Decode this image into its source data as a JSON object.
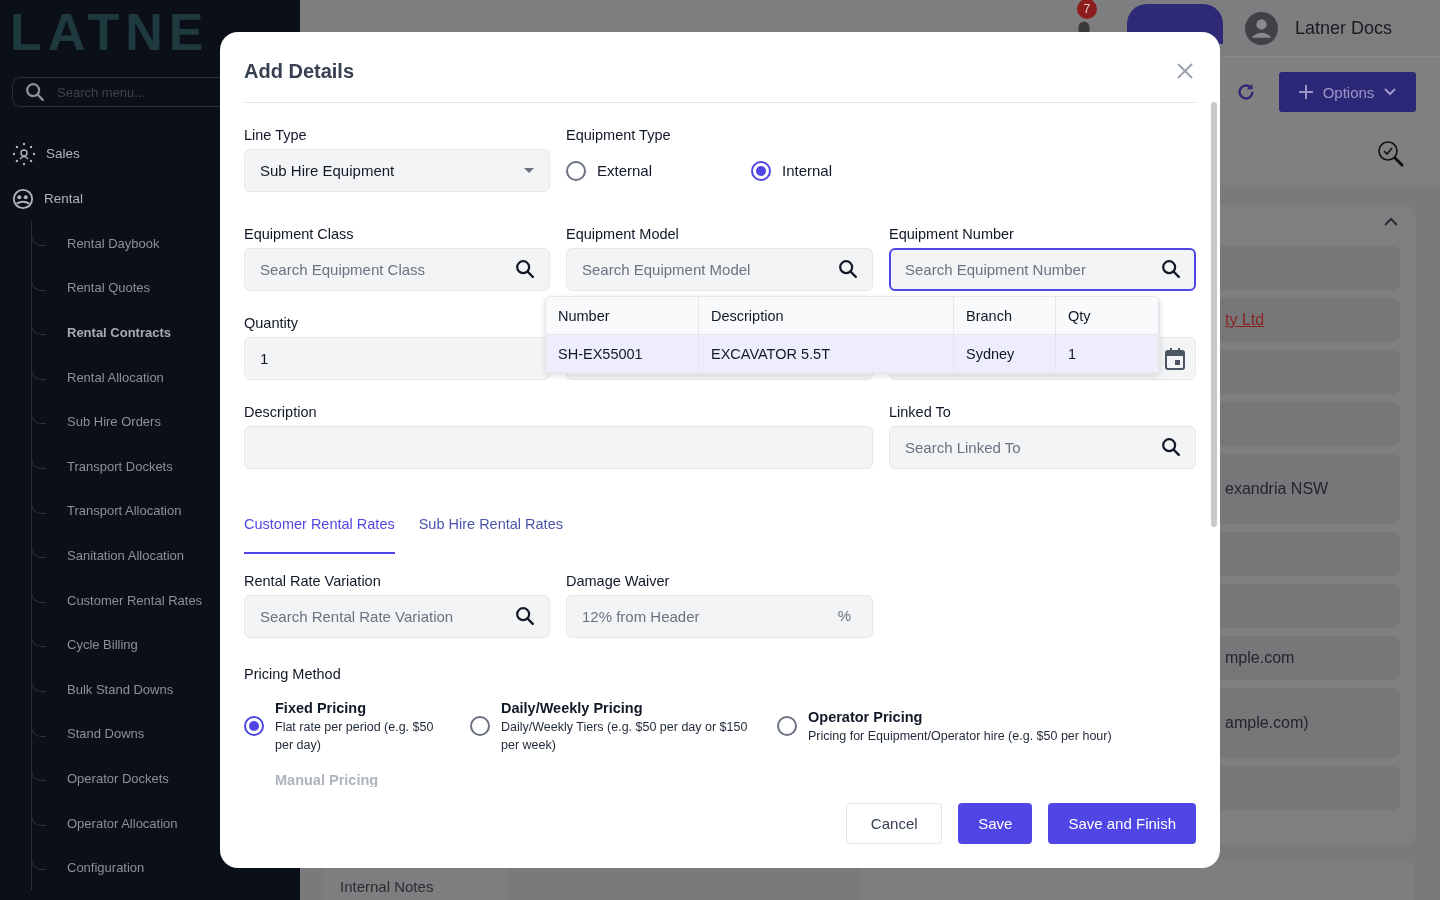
{
  "sidebar": {
    "logo": "LATNE",
    "search": {
      "placeholder": "Search menu..."
    },
    "items": [
      {
        "label": "Sales"
      },
      {
        "label": "Rental",
        "children": [
          {
            "label": "Rental Daybook",
            "selected": false
          },
          {
            "label": "Rental Quotes",
            "selected": false
          },
          {
            "label": "Rental Contracts",
            "selected": true
          },
          {
            "label": "Rental Allocation",
            "selected": false
          },
          {
            "label": "Sub Hire Orders",
            "selected": false
          },
          {
            "label": "Transport Dockets",
            "selected": false
          },
          {
            "label": "Transport Allocation",
            "selected": false
          },
          {
            "label": "Sanitation Allocation",
            "selected": false
          },
          {
            "label": "Customer Rental Rates",
            "selected": false
          },
          {
            "label": "Cycle Billing",
            "selected": false
          },
          {
            "label": "Bulk Stand Downs",
            "selected": false
          },
          {
            "label": "Stand Downs",
            "selected": false
          },
          {
            "label": "Operator Dockets",
            "selected": false
          },
          {
            "label": "Operator Allocation",
            "selected": false
          },
          {
            "label": "Configuration",
            "selected": false
          }
        ]
      }
    ]
  },
  "header": {
    "notification_count": "7",
    "user": "Latner Docs"
  },
  "toolbar": {
    "options_button": "Options"
  },
  "detail_rows": [
    {
      "kind": "empty",
      "tall": false
    },
    {
      "kind": "link",
      "text": "ty Ltd",
      "tall": false
    },
    {
      "kind": "empty",
      "tall": false
    },
    {
      "kind": "empty",
      "tall": false
    },
    {
      "kind": "text",
      "text": "exandria NSW",
      "tall": true
    },
    {
      "kind": "empty",
      "tall": false
    },
    {
      "kind": "empty",
      "tall": false
    },
    {
      "kind": "text",
      "text": "mple.com",
      "tall": false
    },
    {
      "kind": "text",
      "text": "ample.com)",
      "tall": true
    },
    {
      "kind": "empty",
      "tall": false
    }
  ],
  "bottom_cards": [
    {
      "title": "Internal Notes"
    }
  ],
  "dialog": {
    "title": "Add Details",
    "line_type": {
      "label": "Line Type",
      "value": "Sub Hire Equipment"
    },
    "equipment_type": {
      "label": "Equipment Type",
      "options": [
        {
          "label": "External",
          "selected": false
        },
        {
          "label": "Internal",
          "selected": true
        }
      ]
    },
    "search_fields": [
      {
        "label": "Equipment Class",
        "placeholder": "Search Equipment Class",
        "focused": false
      },
      {
        "label": "Equipment Model",
        "placeholder": "Search Equipment Model",
        "focused": false
      },
      {
        "label": "Equipment Number",
        "placeholder": "Search Equipment Number",
        "focused": true
      }
    ],
    "quantity": {
      "label": "Quantity",
      "value": "1"
    },
    "lookup": {
      "columns": [
        "Number",
        "Description",
        "Branch",
        "Qty"
      ],
      "rows": [
        {
          "cells": [
            "SH-EX55001",
            "EXCAVATOR 5.5T",
            "Sydney",
            "1"
          ],
          "selected": true
        }
      ]
    },
    "description": {
      "label": "Description"
    },
    "linked_to": {
      "label": "Linked To",
      "placeholder": "Search Linked To"
    },
    "tabs": [
      {
        "label": "Customer Rental Rates",
        "selected": true
      },
      {
        "label": "Sub Hire Rental Rates",
        "selected": false
      }
    ],
    "rate_variation": {
      "label": "Rental Rate Variation",
      "placeholder": "Search Rental Rate Variation"
    },
    "damage_waiver": {
      "label": "Damage Waiver",
      "placeholder": "12% from Header",
      "suffix": "%"
    },
    "pricing_method": {
      "label": "Pricing Method",
      "options": [
        {
          "title": "Fixed Pricing",
          "description": "Flat rate per period (e.g. $50 per day)",
          "selected": true
        },
        {
          "title": "Daily/Weekly Pricing",
          "description": "Daily/Weekly Tiers (e.g. $50 per day or $150 per week)",
          "selected": false
        },
        {
          "title": "Operator Pricing",
          "description": "Pricing for Equipment/Operator hire (e.g. $50 per hour)",
          "selected": false
        },
        {
          "title": "Manual Pricing"
        }
      ]
    },
    "buttons": [
      {
        "label": "Cancel",
        "kind": "secondary"
      },
      {
        "label": "Save",
        "kind": "primary"
      },
      {
        "label": "Save and Finish",
        "kind": "primary"
      }
    ]
  }
}
